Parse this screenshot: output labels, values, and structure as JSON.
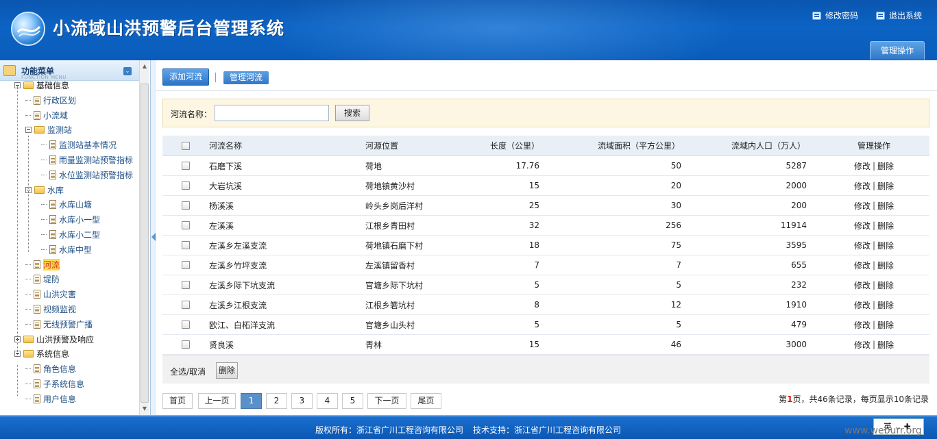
{
  "header": {
    "title": "小流域山洪预警后台管理系统",
    "change_password": "修改密码",
    "logout": "退出系统",
    "manage_tab": "管理操作"
  },
  "sidebar": {
    "title": "功能菜单",
    "subtitle": "FUNCTION MENU",
    "tree": [
      {
        "label": "基础信息",
        "type": "folder",
        "level": 0,
        "expanded": true
      },
      {
        "label": "行政区划",
        "type": "doc",
        "level": 1
      },
      {
        "label": "小流域",
        "type": "doc",
        "level": 1
      },
      {
        "label": "监测站",
        "type": "folder",
        "level": 1,
        "expanded": true
      },
      {
        "label": "监测站基本情况",
        "type": "doc",
        "level": 2
      },
      {
        "label": "雨量监测站预警指标",
        "type": "doc",
        "level": 2
      },
      {
        "label": "水位监测站预警指标",
        "type": "doc",
        "level": 2
      },
      {
        "label": "水库",
        "type": "folder",
        "level": 1,
        "expanded": true
      },
      {
        "label": "水库山塘",
        "type": "doc",
        "level": 2
      },
      {
        "label": "水库小一型",
        "type": "doc",
        "level": 2
      },
      {
        "label": "水库小二型",
        "type": "doc",
        "level": 2
      },
      {
        "label": "水库中型",
        "type": "doc",
        "level": 2
      },
      {
        "label": "河流",
        "type": "doc",
        "level": 1,
        "active": true
      },
      {
        "label": "堤防",
        "type": "doc",
        "level": 1
      },
      {
        "label": "山洪灾害",
        "type": "doc",
        "level": 1
      },
      {
        "label": "视频监视",
        "type": "doc",
        "level": 1
      },
      {
        "label": "无线预警广播",
        "type": "doc",
        "level": 1
      },
      {
        "label": "山洪预警及响应",
        "type": "folder",
        "level": 0,
        "expanded": false
      },
      {
        "label": "系统信息",
        "type": "folder",
        "level": 0,
        "expanded": true
      },
      {
        "label": "角色信息",
        "type": "doc",
        "level": 1
      },
      {
        "label": "子系统信息",
        "type": "doc",
        "level": 1
      },
      {
        "label": "用户信息",
        "type": "doc",
        "level": 1
      }
    ]
  },
  "toolbar": {
    "add_river": "添加河流",
    "manage_river": "管理河流"
  },
  "search": {
    "label": "河流名称：",
    "value": "",
    "button": "搜索"
  },
  "table": {
    "columns": [
      "河流名称",
      "河源位置",
      "长度（公里）",
      "流域面积（平方公里）",
      "流域内人口（万人）",
      "管理操作"
    ],
    "edit_label": "修改",
    "delete_label": "删除",
    "rows": [
      {
        "name": "石磨下溪",
        "source": "荷地",
        "length": "17.76",
        "area": "50",
        "population": "5287"
      },
      {
        "name": "大岩坑溪",
        "source": "荷地镇黄沙村",
        "length": "15",
        "area": "20",
        "population": "2000"
      },
      {
        "name": "杨溪溪",
        "source": "岭头乡岗后洋村",
        "length": "25",
        "area": "30",
        "population": "200"
      },
      {
        "name": "左溪溪",
        "source": "江根乡青田村",
        "length": "32",
        "area": "256",
        "population": "11914"
      },
      {
        "name": "左溪乡左溪支流",
        "source": "荷地镇石磨下村",
        "length": "18",
        "area": "75",
        "population": "3595"
      },
      {
        "name": "左溪乡竹坪支流",
        "source": "左溪镇留香村",
        "length": "7",
        "area": "7",
        "population": "655"
      },
      {
        "name": "左溪乡际下坑支流",
        "source": "官塘乡际下坑村",
        "length": "5",
        "area": "5",
        "population": "232"
      },
      {
        "name": "左溪乡江根支流",
        "source": "江根乡箬坑村",
        "length": "8",
        "area": "12",
        "population": "1910"
      },
      {
        "name": "欧江、白柘洋支流",
        "source": "官塘乡山头村",
        "length": "5",
        "area": "5",
        "population": "479"
      },
      {
        "name": "贤良溪",
        "source": "青林",
        "length": "15",
        "area": "46",
        "population": "3000"
      }
    ]
  },
  "bulk": {
    "select_all": "全选/取消",
    "delete": "删除"
  },
  "pager": {
    "first": "首页",
    "prev": "上一页",
    "pages": [
      "1",
      "2",
      "3",
      "4",
      "5"
    ],
    "current": "1",
    "next": "下一页",
    "last": "尾页",
    "info_prefix": "第",
    "info_page": "1",
    "info_suffix": "页，共46条记录，每页显示10条记录"
  },
  "footer": {
    "copyright": "版权所有：浙江省广川工程咨询有限公司",
    "support": "技术支持：浙江省广川工程咨询有限公司",
    "lang": "英 ⌄ ✚",
    "watermark": "www.weburr.org"
  }
}
